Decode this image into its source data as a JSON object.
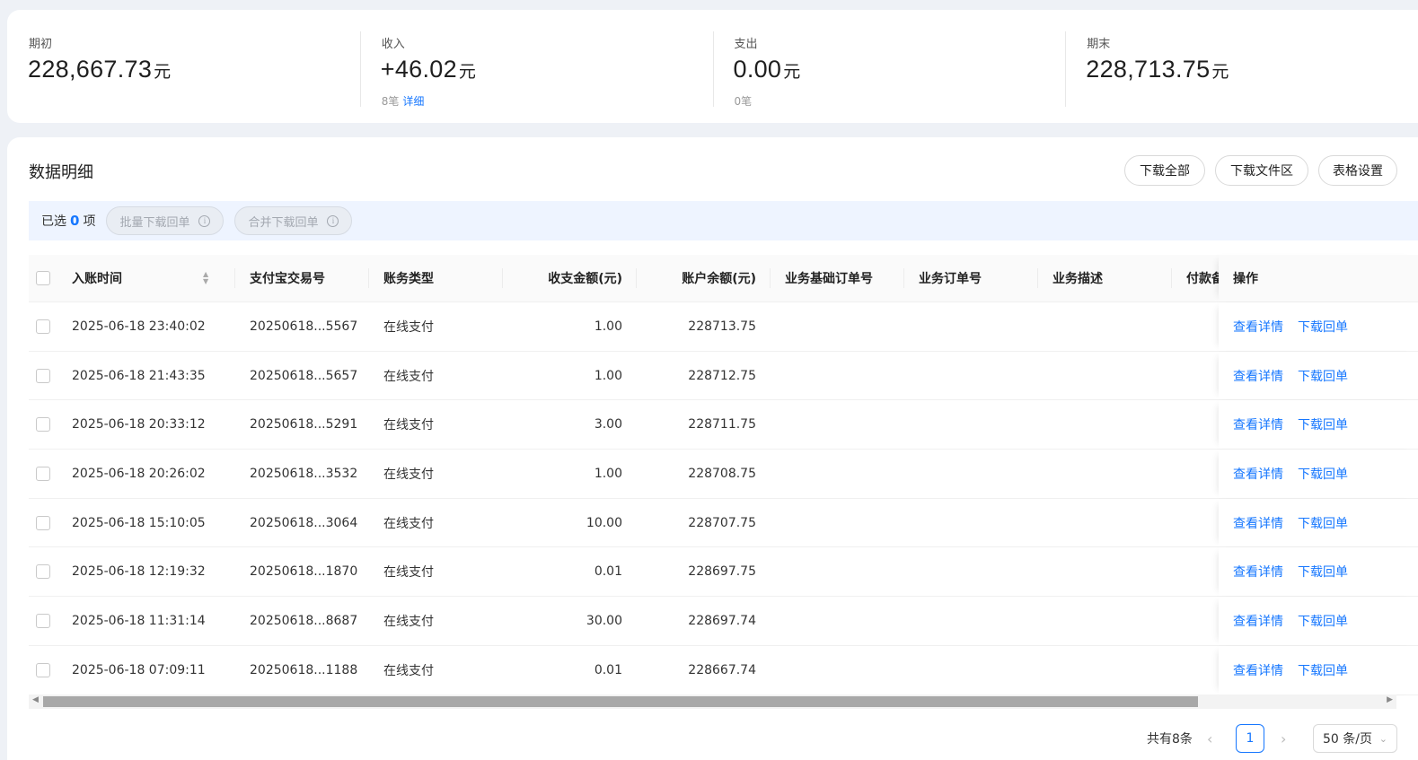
{
  "summary": [
    {
      "label": "期初",
      "amount": "228,667.73",
      "unit": "元",
      "count": "",
      "detail_link": ""
    },
    {
      "label": "收入",
      "amount": "+46.02",
      "unit": "元",
      "count": "8笔",
      "detail_link": "详细"
    },
    {
      "label": "支出",
      "amount": "0.00",
      "unit": "元",
      "count": "0笔",
      "detail_link": ""
    },
    {
      "label": "期末",
      "amount": "228,713.75",
      "unit": "元",
      "count": "",
      "detail_link": ""
    }
  ],
  "section": {
    "title": "数据明细",
    "buttons": [
      "下载全部",
      "下载文件区",
      "表格设置"
    ]
  },
  "selection": {
    "prefix": "已选",
    "count": "0",
    "suffix": "项",
    "batch_download": "批量下载回单",
    "merge_download": "合并下载回单"
  },
  "table": {
    "columns": [
      "入账时间",
      "支付宝交易号",
      "账务类型",
      "收支金额(元)",
      "账户余额(元)",
      "业务基础订单号",
      "业务订单号",
      "业务描述",
      "付款备",
      "操作"
    ],
    "rows": [
      {
        "time": "2025-06-18 23:40:02",
        "trade_no": "20250618...5567",
        "type": "在线支付",
        "amount": "1.00",
        "balance": "228713.75"
      },
      {
        "time": "2025-06-18 21:43:35",
        "trade_no": "20250618...5657",
        "type": "在线支付",
        "amount": "1.00",
        "balance": "228712.75"
      },
      {
        "time": "2025-06-18 20:33:12",
        "trade_no": "20250618...5291",
        "type": "在线支付",
        "amount": "3.00",
        "balance": "228711.75"
      },
      {
        "time": "2025-06-18 20:26:02",
        "trade_no": "20250618...3532",
        "type": "在线支付",
        "amount": "1.00",
        "balance": "228708.75"
      },
      {
        "time": "2025-06-18 15:10:05",
        "trade_no": "20250618...3064",
        "type": "在线支付",
        "amount": "10.00",
        "balance": "228707.75"
      },
      {
        "time": "2025-06-18 12:19:32",
        "trade_no": "20250618...1870",
        "type": "在线支付",
        "amount": "0.01",
        "balance": "228697.75"
      },
      {
        "time": "2025-06-18 11:31:14",
        "trade_no": "20250618...8687",
        "type": "在线支付",
        "amount": "30.00",
        "balance": "228697.74"
      },
      {
        "time": "2025-06-18 07:09:11",
        "trade_no": "20250618...1188",
        "type": "在线支付",
        "amount": "0.01",
        "balance": "228667.74"
      }
    ],
    "actions": [
      "查看详情",
      "下载回单"
    ]
  },
  "pagination": {
    "total": "共有8条",
    "current": "1",
    "page_size": "50 条/页"
  },
  "colors": {
    "accent": "#1677ff",
    "selbar_bg": "#eef4ff"
  }
}
